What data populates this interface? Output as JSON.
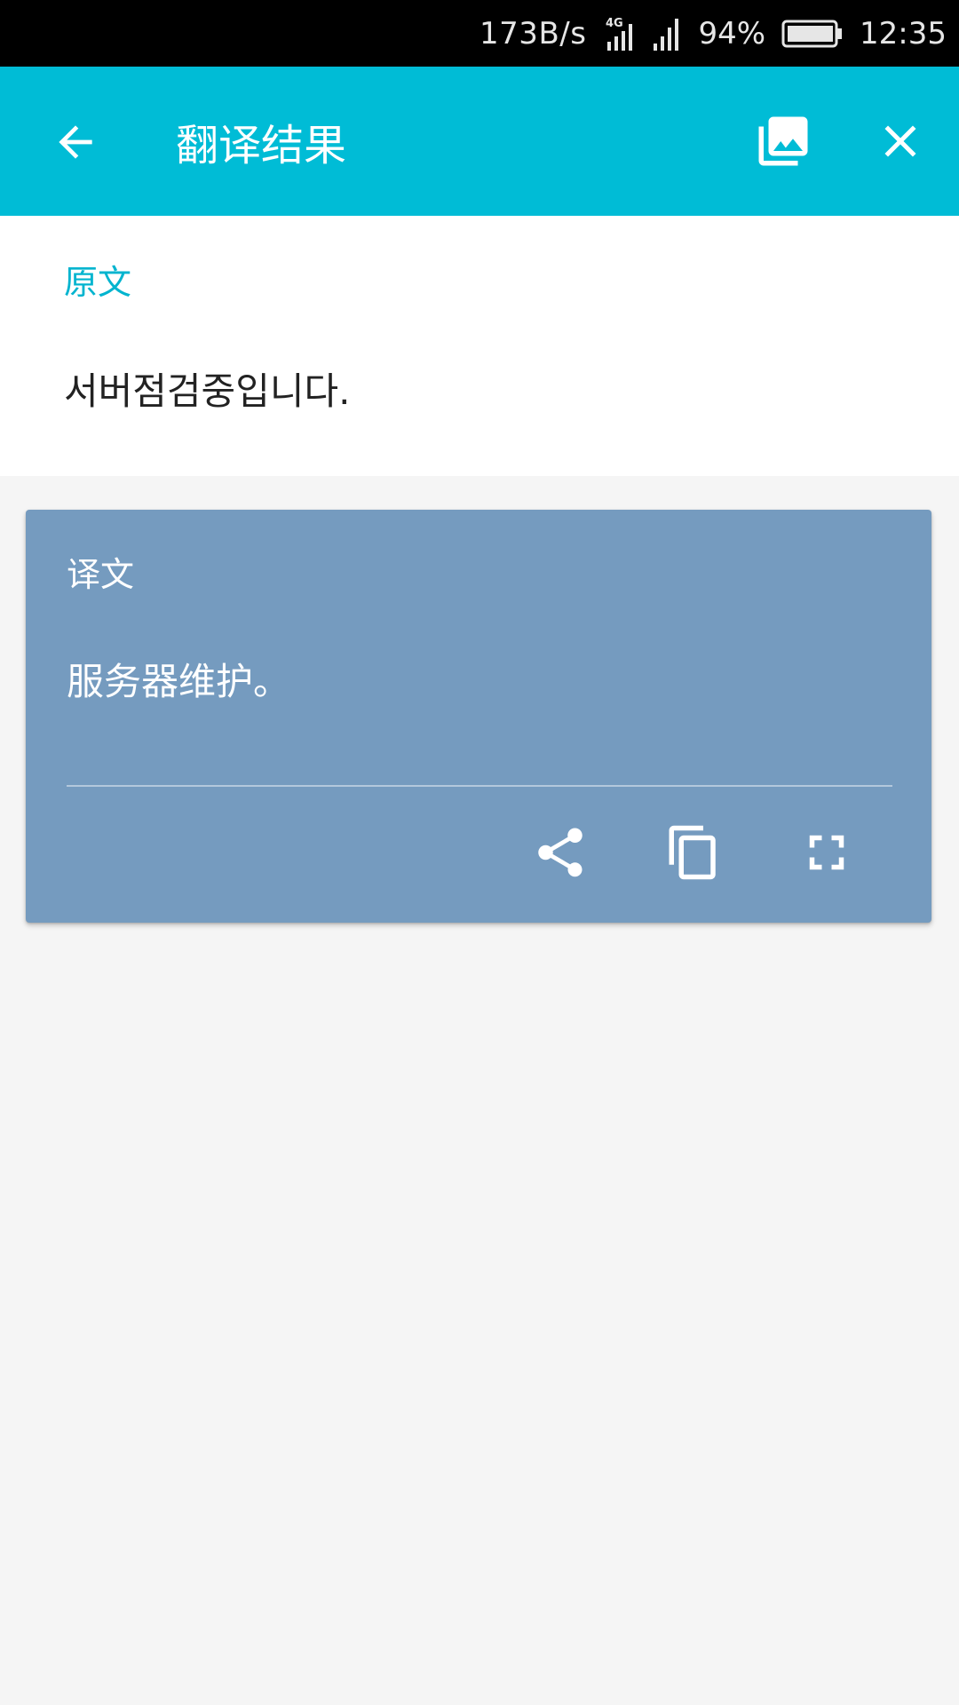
{
  "status_bar": {
    "net_speed": "173B/s",
    "network_type": "4G",
    "battery_percent": "94%",
    "time": "12:35",
    "icons": [
      "signal-4g-icon",
      "signal-icon",
      "battery-icon"
    ]
  },
  "app_bar": {
    "title": "翻译结果",
    "icons": [
      "back-arrow-icon",
      "gallery-icon",
      "close-icon"
    ],
    "background_color": "#00bcd6"
  },
  "source": {
    "label": "原文",
    "text": "서버점검중입니다.",
    "label_color": "#00b4cf"
  },
  "translation": {
    "label": "译文",
    "text": "服务器维护。",
    "card_color": "#759bbf",
    "actions": [
      "share-icon",
      "copy-icon",
      "fullscreen-icon"
    ]
  }
}
